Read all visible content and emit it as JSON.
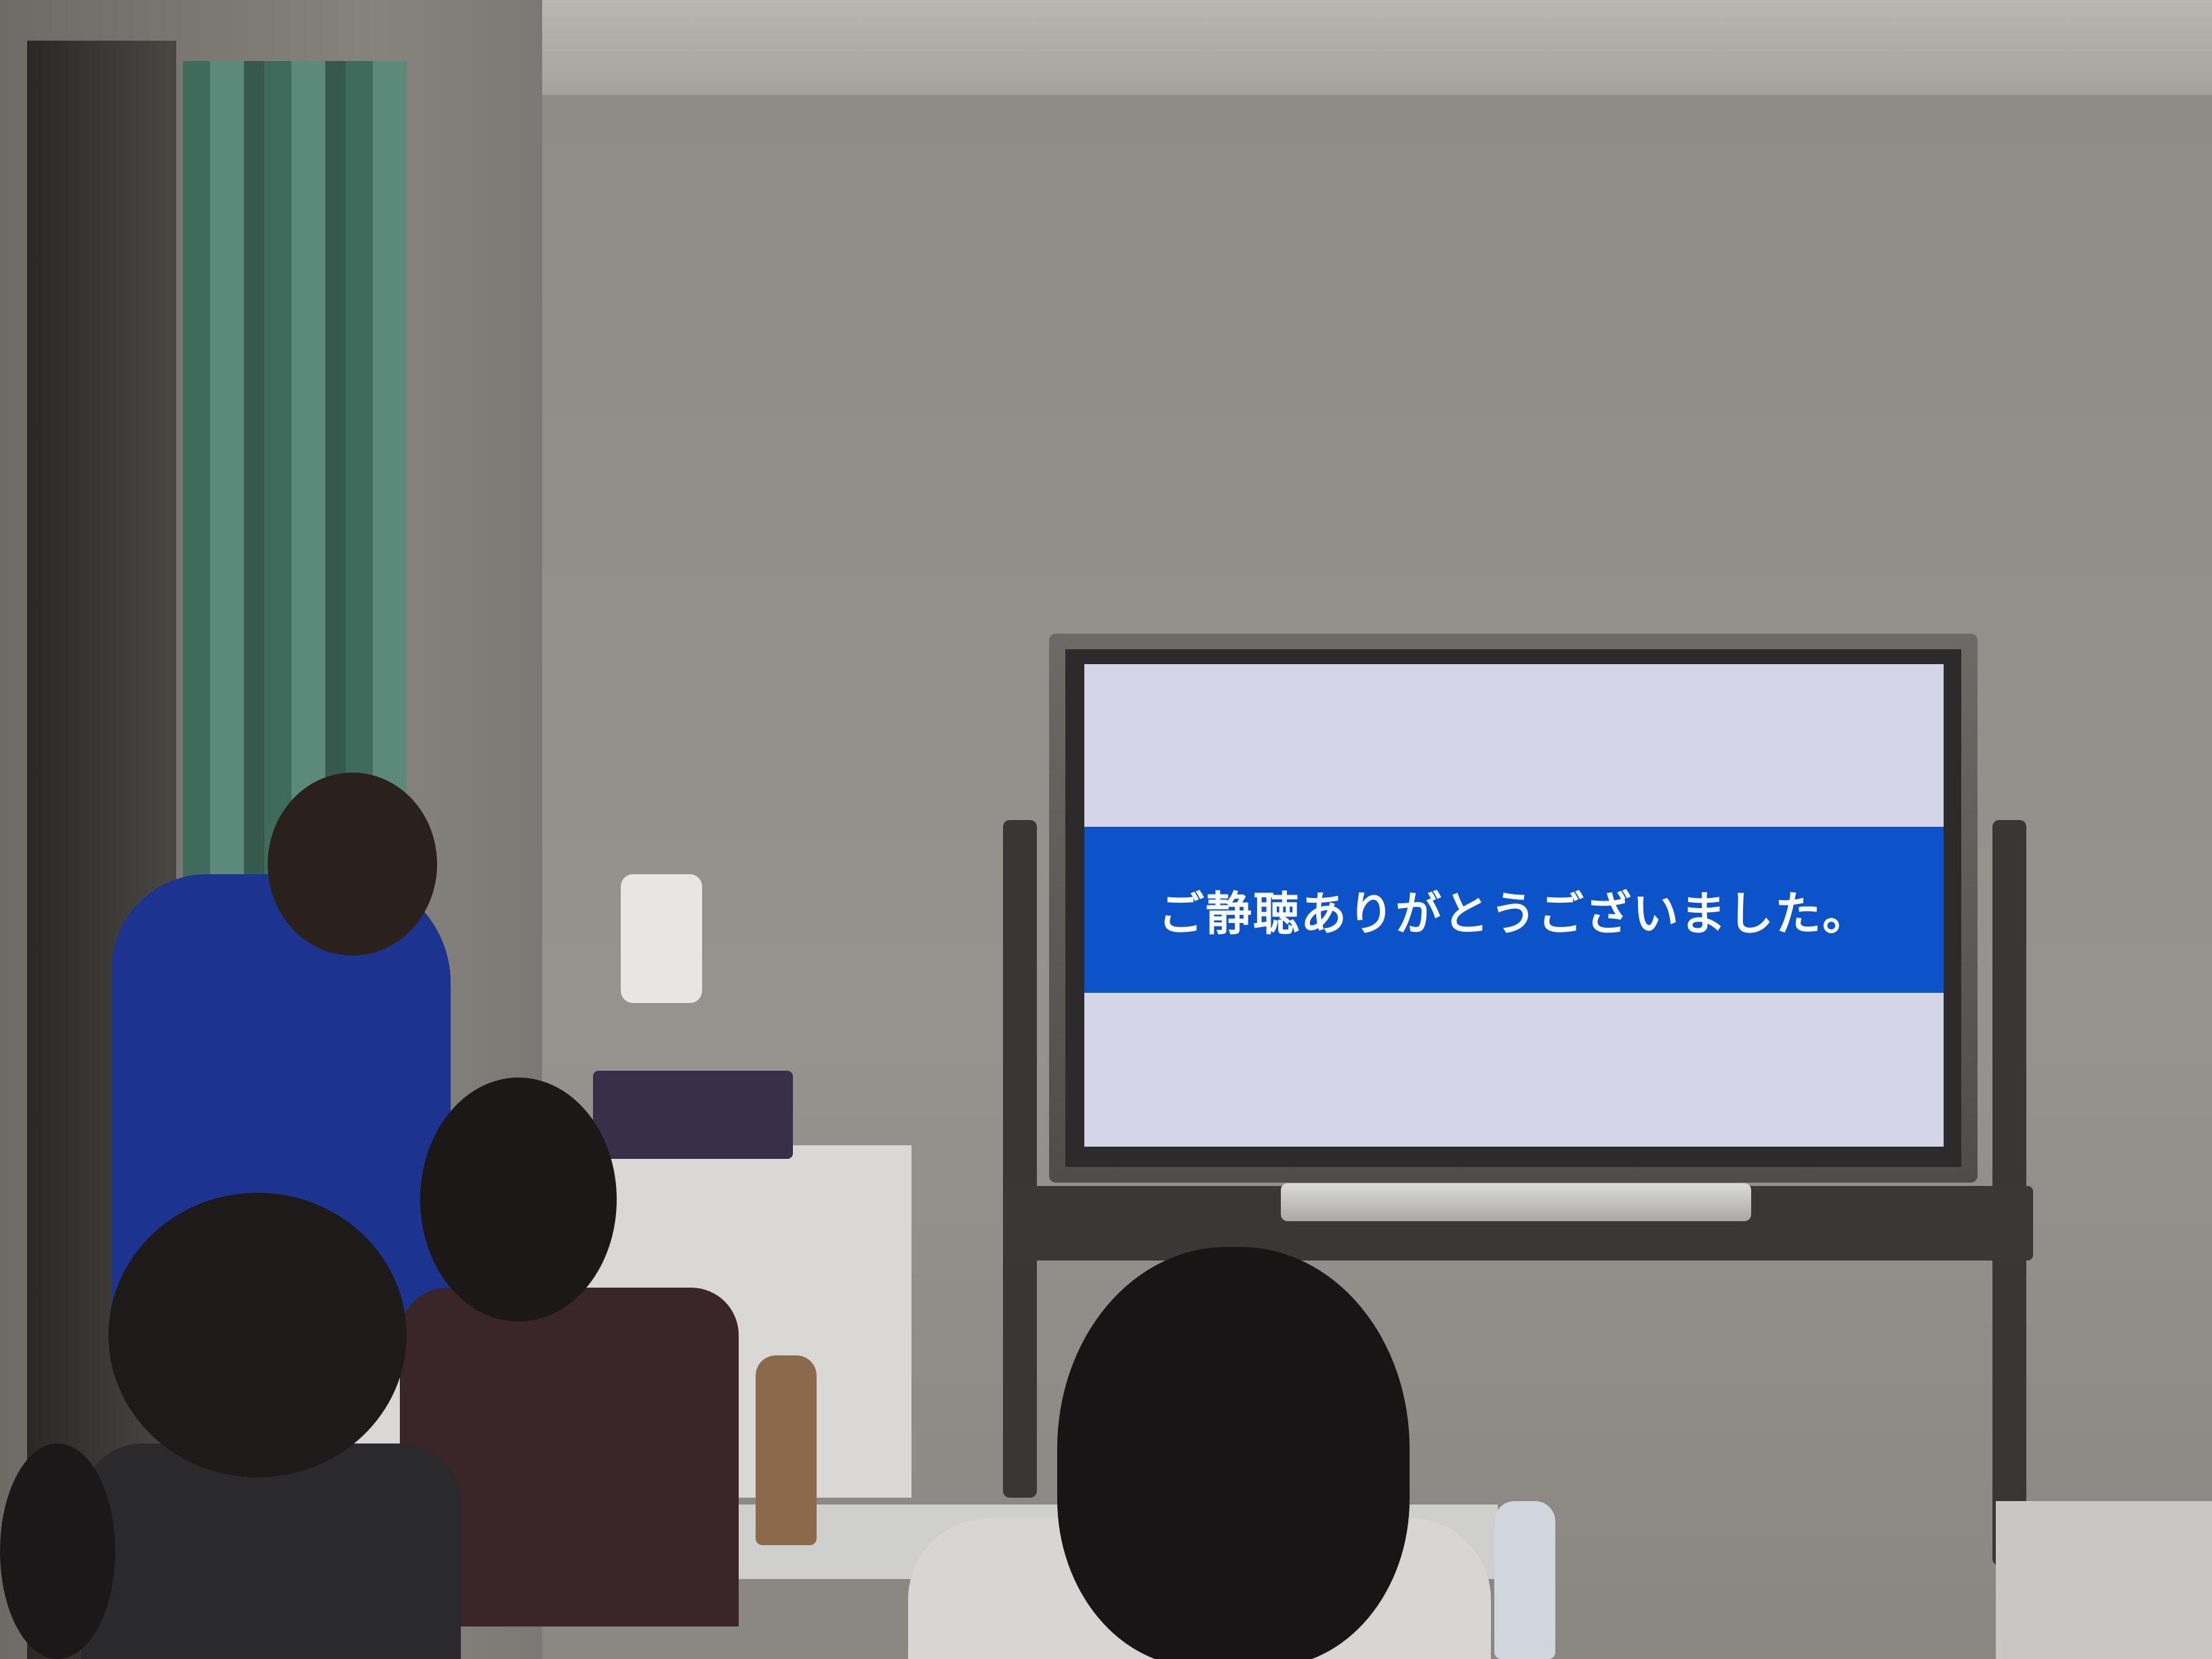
{
  "scene": {
    "description_colors": {
      "wall": "#8f8c88",
      "screen_background": "#d4d5e6",
      "slide_band": "#0c52c8",
      "slide_text": "#ffffff",
      "curtain": "#4f7f6f",
      "presenter_jacket": "#1c3490"
    }
  },
  "slide": {
    "text": "ご静聴ありがとうございました。"
  }
}
